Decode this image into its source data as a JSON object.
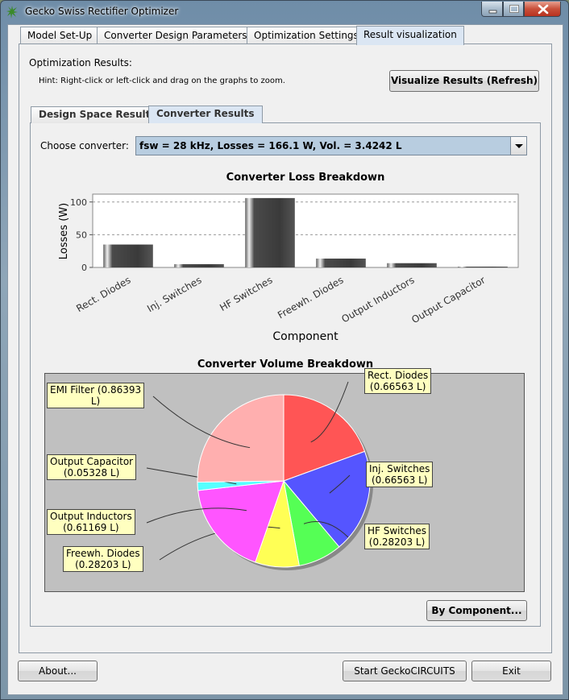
{
  "window": {
    "title": "Gecko Swiss Rectifier Optimizer"
  },
  "tabs": [
    {
      "label": "Model Set-Up"
    },
    {
      "label": "Converter Design Parameters"
    },
    {
      "label": "Optimization Settings"
    },
    {
      "label": "Result visualization"
    }
  ],
  "results": {
    "heading": "Optimization Results:",
    "hint": "Hint: Right-click or left-click and drag on the graphs to zoom.",
    "visualize_label": "Visualize Results (Refresh)"
  },
  "subtabs": [
    {
      "label": "Design Space Results"
    },
    {
      "label": "Converter Results"
    }
  ],
  "converter": {
    "choose_label": "Choose converter:",
    "selected": "fsw = 28 kHz, Losses = 166.1 W, Vol. = 3.4242 L"
  },
  "buttons": {
    "by_component": "By Component...",
    "about": "About...",
    "start_gecko": "Start GeckoCIRCUITS",
    "exit": "Exit"
  },
  "colors": {
    "accent_tab": "#dbe6f3",
    "select_bg": "#b8cde0",
    "callout_bg": "#ffffc0"
  },
  "chart_data": [
    {
      "type": "bar",
      "title": "Converter Loss Breakdown",
      "xlabel": "Component",
      "ylabel": "Losses (W)",
      "categories": [
        "Rect. Diodes",
        "Inj. Switches",
        "HF Switches",
        "Freewh. Diodes",
        "Output Inductors",
        "Output Capacitor"
      ],
      "values": [
        35,
        5,
        106,
        13.5,
        6.5,
        0.5
      ],
      "ylim": [
        0,
        112
      ],
      "yticks": [
        "0",
        "50",
        "100"
      ],
      "grid": true
    },
    {
      "type": "pie",
      "title": "Converter Volume Breakdown",
      "slices": [
        {
          "label": "Rect. Diodes",
          "display": "Rect. Diodes\n(0.66563 L)",
          "value": 0.66563,
          "color": "#ff5555"
        },
        {
          "label": "Inj. Switches",
          "display": "Inj. Switches\n(0.66563 L)",
          "value": 0.66563,
          "color": "#5555ff"
        },
        {
          "label": "HF Switches",
          "display": "HF Switches\n(0.28203 L)",
          "value": 0.28203,
          "color": "#55ff55"
        },
        {
          "label": "Freewh. Diodes",
          "display": "Freewh. Diodes\n(0.28203 L)",
          "value": 0.28203,
          "color": "#ffff55"
        },
        {
          "label": "Output Inductors",
          "display": "Output Inductors\n(0.61169 L)",
          "value": 0.61169,
          "color": "#ff55ff"
        },
        {
          "label": "Output Capacitor",
          "display": "Output Capacitor\n(0.05328 L)",
          "value": 0.05328,
          "color": "#55ffff"
        },
        {
          "label": "EMI Filter",
          "display": "EMI Filter (0.86393\nL)",
          "value": 0.86393,
          "color": "#ffafaf"
        }
      ]
    }
  ]
}
